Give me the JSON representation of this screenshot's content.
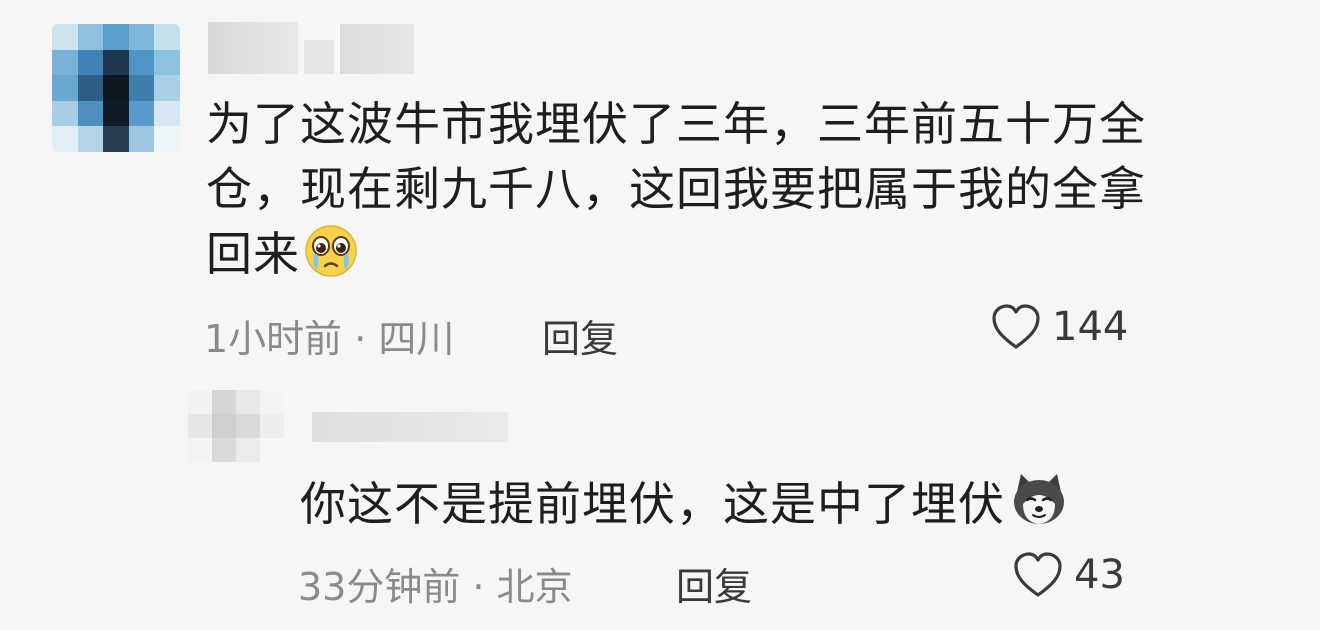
{
  "comment": {
    "text_line1": "为了这波牛市我埋伏了三年，三年前五十万全",
    "text_line2": "仓，现在剩九千八，这回我要把属于我的全拿",
    "text_line3": "回来",
    "emoji": "crying-face-icon",
    "meta": "1小时前 · 四川",
    "reply_label": "回复",
    "like_icon": "heart-outline-icon",
    "like_count": "144"
  },
  "reply": {
    "text": "你这不是提前埋伏，这是中了埋伏",
    "emoji": "doge-icon",
    "meta": "33分钟前 · 北京",
    "reply_label": "回复",
    "like_icon": "heart-outline-icon",
    "like_count": "43"
  },
  "colors": {
    "background": "#f6f6f6",
    "text": "#1e1e1e",
    "meta": "#8a8a8a",
    "avatar_blue": "#4a8fc0"
  }
}
